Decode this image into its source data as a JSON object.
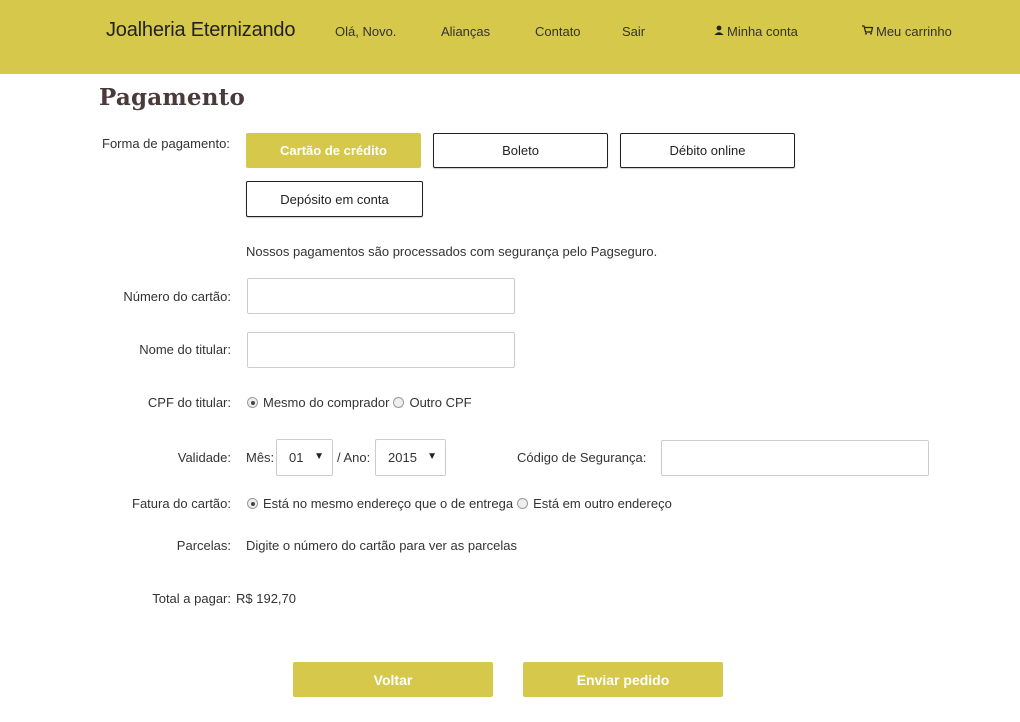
{
  "header": {
    "brand": "Joalheria Eternizando",
    "greeting": "Olá, Novo.",
    "nav": [
      "Alianças",
      "Contato",
      "Sair"
    ],
    "account": {
      "icon": "user-icon",
      "label": "Minha conta"
    },
    "cart": {
      "icon": "cart-icon",
      "label": "Meu carrinho"
    },
    "bg_color": "#d6c84a"
  },
  "page": {
    "title": "Pagamento"
  },
  "payment": {
    "label": "Forma de pagamento:",
    "options": [
      "Cartão de crédito",
      "Boleto",
      "Débito online",
      "Depósito em conta"
    ],
    "selected": "Cartão de crédito",
    "note": "Nossos pagamentos são processados com segurança pelo Pagseguro."
  },
  "form": {
    "card_number_label": "Número do cartão:",
    "card_number_value": "",
    "holder_name_label": "Nome do titular:",
    "holder_name_value": "",
    "cpf_label": "CPF do titular:",
    "cpf_options": [
      "Mesmo do comprador",
      "Outro CPF"
    ],
    "cpf_selected": "Mesmo do comprador",
    "validity_label": "Validade:",
    "month_label": "Mês:",
    "month_value": "01",
    "year_label": "/ Ano:",
    "year_value": "2015",
    "security_code_label": "Código de Segurança:",
    "security_code_value": "",
    "billing_label": "Fatura do cartão:",
    "billing_options": [
      "Está no mesmo endereço que o de entrega",
      "Está em outro endereço"
    ],
    "billing_selected": "Está no mesmo endereço que o de entrega",
    "installments_label": "Parcelas:",
    "installments_text": "Digite o número do cartão para ver as parcelas",
    "total_label": "Total a pagar:",
    "total_value": "R$ 192,70"
  },
  "actions": {
    "back": "Voltar",
    "submit": "Enviar pedido"
  }
}
